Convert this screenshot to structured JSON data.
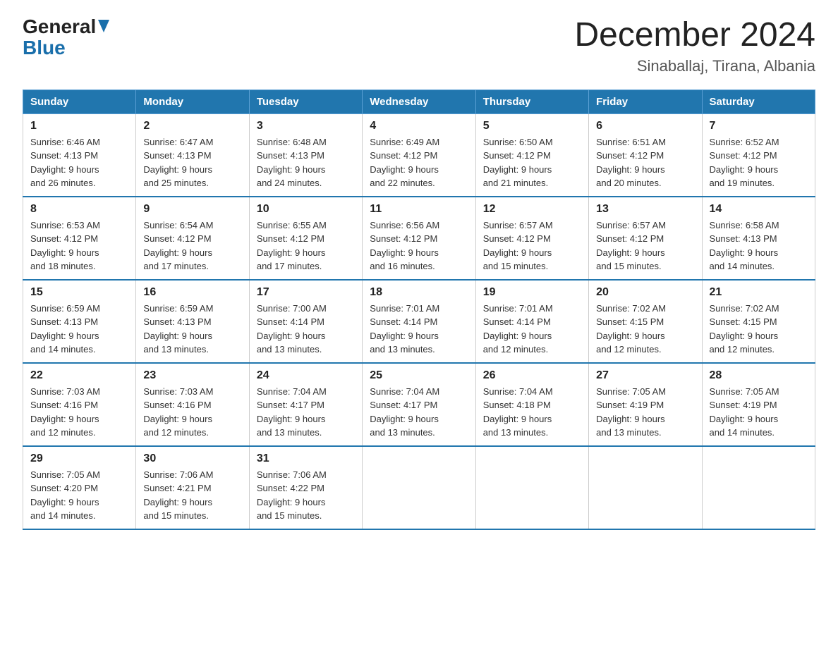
{
  "header": {
    "logo_general": "General",
    "logo_blue": "Blue",
    "main_title": "December 2024",
    "subtitle": "Sinaballaj, Tirana, Albania"
  },
  "days_of_week": [
    "Sunday",
    "Monday",
    "Tuesday",
    "Wednesday",
    "Thursday",
    "Friday",
    "Saturday"
  ],
  "weeks": [
    [
      {
        "day": "1",
        "sunrise": "6:46 AM",
        "sunset": "4:13 PM",
        "daylight": "9 hours and 26 minutes."
      },
      {
        "day": "2",
        "sunrise": "6:47 AM",
        "sunset": "4:13 PM",
        "daylight": "9 hours and 25 minutes."
      },
      {
        "day": "3",
        "sunrise": "6:48 AM",
        "sunset": "4:13 PM",
        "daylight": "9 hours and 24 minutes."
      },
      {
        "day": "4",
        "sunrise": "6:49 AM",
        "sunset": "4:12 PM",
        "daylight": "9 hours and 22 minutes."
      },
      {
        "day": "5",
        "sunrise": "6:50 AM",
        "sunset": "4:12 PM",
        "daylight": "9 hours and 21 minutes."
      },
      {
        "day": "6",
        "sunrise": "6:51 AM",
        "sunset": "4:12 PM",
        "daylight": "9 hours and 20 minutes."
      },
      {
        "day": "7",
        "sunrise": "6:52 AM",
        "sunset": "4:12 PM",
        "daylight": "9 hours and 19 minutes."
      }
    ],
    [
      {
        "day": "8",
        "sunrise": "6:53 AM",
        "sunset": "4:12 PM",
        "daylight": "9 hours and 18 minutes."
      },
      {
        "day": "9",
        "sunrise": "6:54 AM",
        "sunset": "4:12 PM",
        "daylight": "9 hours and 17 minutes."
      },
      {
        "day": "10",
        "sunrise": "6:55 AM",
        "sunset": "4:12 PM",
        "daylight": "9 hours and 17 minutes."
      },
      {
        "day": "11",
        "sunrise": "6:56 AM",
        "sunset": "4:12 PM",
        "daylight": "9 hours and 16 minutes."
      },
      {
        "day": "12",
        "sunrise": "6:57 AM",
        "sunset": "4:12 PM",
        "daylight": "9 hours and 15 minutes."
      },
      {
        "day": "13",
        "sunrise": "6:57 AM",
        "sunset": "4:12 PM",
        "daylight": "9 hours and 15 minutes."
      },
      {
        "day": "14",
        "sunrise": "6:58 AM",
        "sunset": "4:13 PM",
        "daylight": "9 hours and 14 minutes."
      }
    ],
    [
      {
        "day": "15",
        "sunrise": "6:59 AM",
        "sunset": "4:13 PM",
        "daylight": "9 hours and 14 minutes."
      },
      {
        "day": "16",
        "sunrise": "6:59 AM",
        "sunset": "4:13 PM",
        "daylight": "9 hours and 13 minutes."
      },
      {
        "day": "17",
        "sunrise": "7:00 AM",
        "sunset": "4:14 PM",
        "daylight": "9 hours and 13 minutes."
      },
      {
        "day": "18",
        "sunrise": "7:01 AM",
        "sunset": "4:14 PM",
        "daylight": "9 hours and 13 minutes."
      },
      {
        "day": "19",
        "sunrise": "7:01 AM",
        "sunset": "4:14 PM",
        "daylight": "9 hours and 12 minutes."
      },
      {
        "day": "20",
        "sunrise": "7:02 AM",
        "sunset": "4:15 PM",
        "daylight": "9 hours and 12 minutes."
      },
      {
        "day": "21",
        "sunrise": "7:02 AM",
        "sunset": "4:15 PM",
        "daylight": "9 hours and 12 minutes."
      }
    ],
    [
      {
        "day": "22",
        "sunrise": "7:03 AM",
        "sunset": "4:16 PM",
        "daylight": "9 hours and 12 minutes."
      },
      {
        "day": "23",
        "sunrise": "7:03 AM",
        "sunset": "4:16 PM",
        "daylight": "9 hours and 12 minutes."
      },
      {
        "day": "24",
        "sunrise": "7:04 AM",
        "sunset": "4:17 PM",
        "daylight": "9 hours and 13 minutes."
      },
      {
        "day": "25",
        "sunrise": "7:04 AM",
        "sunset": "4:17 PM",
        "daylight": "9 hours and 13 minutes."
      },
      {
        "day": "26",
        "sunrise": "7:04 AM",
        "sunset": "4:18 PM",
        "daylight": "9 hours and 13 minutes."
      },
      {
        "day": "27",
        "sunrise": "7:05 AM",
        "sunset": "4:19 PM",
        "daylight": "9 hours and 13 minutes."
      },
      {
        "day": "28",
        "sunrise": "7:05 AM",
        "sunset": "4:19 PM",
        "daylight": "9 hours and 14 minutes."
      }
    ],
    [
      {
        "day": "29",
        "sunrise": "7:05 AM",
        "sunset": "4:20 PM",
        "daylight": "9 hours and 14 minutes."
      },
      {
        "day": "30",
        "sunrise": "7:06 AM",
        "sunset": "4:21 PM",
        "daylight": "9 hours and 15 minutes."
      },
      {
        "day": "31",
        "sunrise": "7:06 AM",
        "sunset": "4:22 PM",
        "daylight": "9 hours and 15 minutes."
      },
      null,
      null,
      null,
      null
    ]
  ],
  "labels": {
    "sunrise": "Sunrise:",
    "sunset": "Sunset:",
    "daylight": "Daylight:"
  }
}
